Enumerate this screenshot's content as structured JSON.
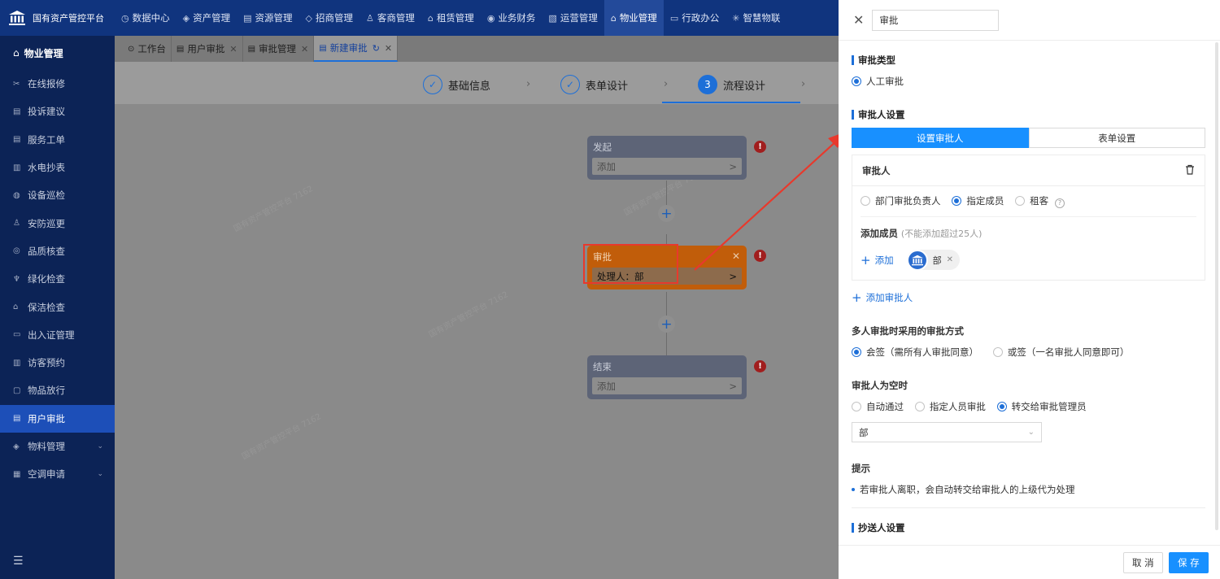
{
  "app": {
    "title": "国有资产管控平台"
  },
  "topnav": [
    {
      "icon": "◷",
      "label": "数据中心"
    },
    {
      "icon": "◈",
      "label": "资产管理"
    },
    {
      "icon": "▤",
      "label": "资源管理"
    },
    {
      "icon": "◇",
      "label": "招商管理"
    },
    {
      "icon": "♙",
      "label": "客商管理"
    },
    {
      "icon": "⌂",
      "label": "租赁管理"
    },
    {
      "icon": "◉",
      "label": "业务财务"
    },
    {
      "icon": "▧",
      "label": "运营管理"
    },
    {
      "icon": "⌂",
      "label": "物业管理"
    },
    {
      "icon": "▭",
      "label": "行政办公"
    },
    {
      "icon": "✳",
      "label": "智慧物联"
    }
  ],
  "sidebar": {
    "header": {
      "icon": "⌂",
      "label": "物业管理"
    },
    "items": [
      {
        "icon": "✂",
        "label": "在线报修"
      },
      {
        "icon": "▤",
        "label": "投诉建议"
      },
      {
        "icon": "▤",
        "label": "服务工单"
      },
      {
        "icon": "▥",
        "label": "水电抄表"
      },
      {
        "icon": "◍",
        "label": "设备巡检"
      },
      {
        "icon": "♙",
        "label": "安防巡更"
      },
      {
        "icon": "◎",
        "label": "品质核查"
      },
      {
        "icon": "♆",
        "label": "绿化检查"
      },
      {
        "icon": "⌂",
        "label": "保洁检查"
      },
      {
        "icon": "▭",
        "label": "出入证管理"
      },
      {
        "icon": "▥",
        "label": "访客预约"
      },
      {
        "icon": "▢",
        "label": "物品放行"
      },
      {
        "icon": "▤",
        "label": "用户审批"
      },
      {
        "icon": "◈",
        "label": "物料管理",
        "caret": "⌄"
      },
      {
        "icon": "▦",
        "label": "空调申请",
        "caret": "⌄"
      }
    ]
  },
  "tabs": [
    {
      "icon": "⊙",
      "label": "工作台",
      "closable": false
    },
    {
      "icon": "▤",
      "label": "用户审批",
      "closable": true
    },
    {
      "icon": "▤",
      "label": "审批管理",
      "closable": true
    },
    {
      "icon": "▤",
      "label": "新建审批",
      "closable": true
    }
  ],
  "steps": [
    {
      "label": "基础信息",
      "mark": "✓"
    },
    {
      "label": "表单设计",
      "mark": "✓"
    },
    {
      "label": "流程设计",
      "mark": "3"
    }
  ],
  "flow": {
    "start": {
      "title": "发起",
      "body": "添加"
    },
    "approve": {
      "title": "审批",
      "body": "处理人：部"
    },
    "end": {
      "title": "结束",
      "body": "添加"
    },
    "warn": "!",
    "plus": "+",
    "chevron": ">",
    "close": "✕"
  },
  "panel": {
    "search_value": "审批",
    "approval_type_title": "审批类型",
    "approval_type_option": "人工审批",
    "approver_settings_title": "审批人设置",
    "segments": [
      "设置审批人",
      "表单设置"
    ],
    "approver_card_title": "审批人",
    "approver_options": [
      "部门审批负责人",
      "指定成员",
      "租客"
    ],
    "add_members_label": "添加成员",
    "add_members_hint": "(不能添加超过25人)",
    "add_label": "添加",
    "member_chip": "部",
    "add_approver": "添加审批人",
    "multi_title": "多人审批时采用的审批方式",
    "multi_options": [
      "会签（需所有人审批同意）",
      "或签（一名审批人同意即可）"
    ],
    "empty_title": "审批人为空时",
    "empty_options": [
      "自动通过",
      "指定人员审批",
      "转交给审批管理员"
    ],
    "select_value": "部",
    "tip_title": "提示",
    "tip_text": "若审批人离职，会自动转交给审批人的上级代为处理",
    "cc_title": "抄送人设置",
    "cancel": "取 消",
    "save": "保 存"
  },
  "colors": {
    "primary": "#1890ff",
    "nav_bg": "#10347e",
    "sidebar_bg": "#0c2356",
    "highlight": "#e8392c",
    "node_orange": "#c15d0a"
  }
}
